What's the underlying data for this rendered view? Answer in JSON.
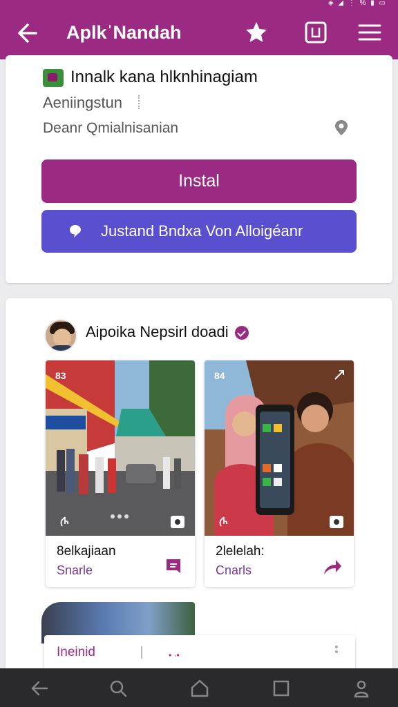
{
  "status_bar": {
    "icons_text": "◈ ◢ ⋮ % ▮ ▭"
  },
  "app_bar": {
    "title": "AplkˈNandah",
    "icons": [
      "back-arrow-icon",
      "star-icon",
      "square-box-icon",
      "hamburger-menu-icon"
    ]
  },
  "app_card": {
    "name": "Innalk kana hlknhinagiam",
    "developer": "Aeniingstun",
    "location": "Deanr Qmialnisanian",
    "install_label": "Instal",
    "secondary_label": "Justand Bndxa Von Alloigéanr",
    "colors": {
      "primary": "#9b2a83",
      "secondary": "#5a4fcf"
    }
  },
  "feed": {
    "poster_name": "Aipoika Nepsirl doadi",
    "tiles": [
      {
        "badge": "83",
        "caption": "8elkajiaan",
        "sub_label": "Snarle",
        "action_icon": "bookmark-icon"
      },
      {
        "badge": "84",
        "caption": "2lelelah:",
        "sub_label": "Cnarls",
        "action_icon": "share-arrow-icon"
      }
    ],
    "peek_card": {
      "label": "Ineinid",
      "mark": "• ·•"
    }
  },
  "nav_bar": {
    "icons": [
      "back-icon",
      "search-icon",
      "home-icon",
      "recents-icon",
      "account-icon"
    ]
  }
}
